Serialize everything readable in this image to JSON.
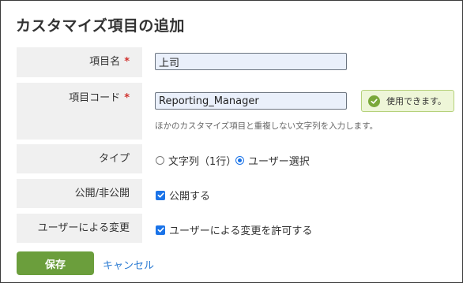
{
  "dialog": {
    "title": "カスタマイズ項目の追加"
  },
  "fields": {
    "name": {
      "label": "項目名",
      "required_mark": "*",
      "value": "上司"
    },
    "code": {
      "label": "項目コード",
      "required_mark": "*",
      "value": "Reporting_Manager",
      "status": "使用できます。",
      "help": "ほかのカスタマイズ項目と重複しない文字列を入力します。"
    },
    "type": {
      "label": "タイプ",
      "options": [
        {
          "label": "文字列（1行）",
          "selected": false
        },
        {
          "label": "ユーザー選択",
          "selected": true
        }
      ]
    },
    "visibility": {
      "label": "公開/非公開",
      "checkbox_label": "公開する",
      "checked": true
    },
    "user_change": {
      "label": "ユーザーによる変更",
      "checkbox_label": "ユーザーによる変更を許可する",
      "checked": true
    }
  },
  "actions": {
    "save_label": "保存",
    "cancel_label": "キャンセル"
  },
  "colors": {
    "accent": "#1a73e8",
    "save_button": "#6b9e3c",
    "link": "#2a7ad2",
    "required": "#d0312d",
    "status_bg": "#eef6d8",
    "label_bg": "#f0f0f0"
  },
  "icons": {
    "status": "check-circle-icon",
    "checkbox": "checkmark-icon"
  }
}
